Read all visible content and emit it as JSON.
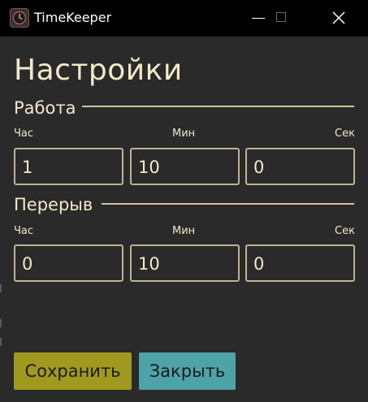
{
  "window": {
    "title": "TimeKeeper",
    "icon": "clock-icon"
  },
  "page": {
    "title": "Настройки"
  },
  "work": {
    "label": "Работа",
    "columns": [
      "Час",
      "Мин",
      "Сек"
    ],
    "hours": "1",
    "minutes": "10",
    "seconds": "0"
  },
  "break": {
    "label": "Перерыв",
    "columns": [
      "Час",
      "Мин",
      "Сек"
    ],
    "hours": "0",
    "minutes": "10",
    "seconds": "0"
  },
  "buttons": {
    "save_label": "Сохранить",
    "close_label": "Закрыть"
  },
  "colors": {
    "background": "#2a2a2a",
    "text": "#f1e9c8",
    "save_button": "#a0991e",
    "close_button": "#4ea3a8"
  }
}
